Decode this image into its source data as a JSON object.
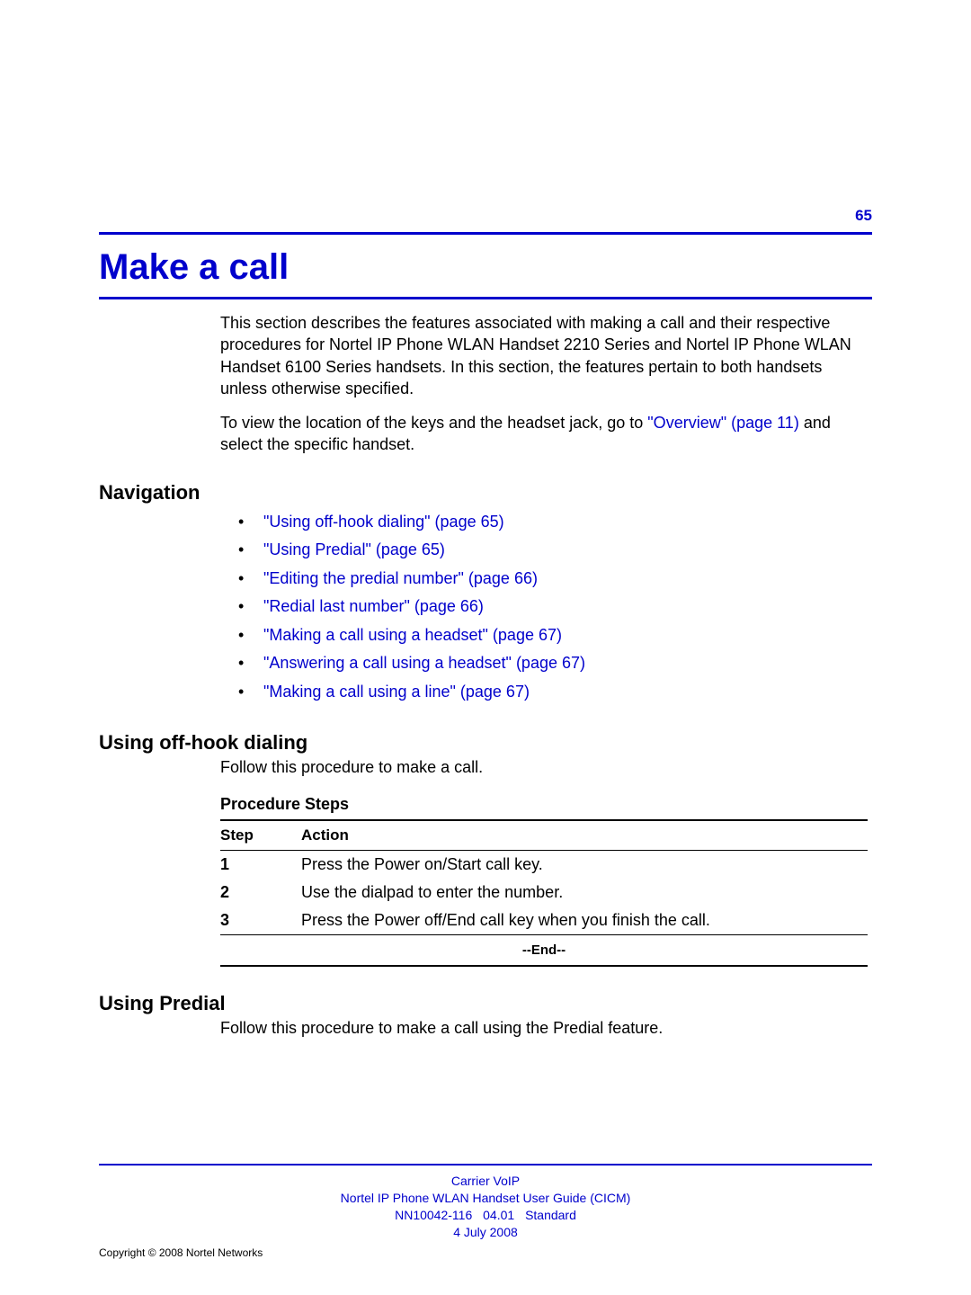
{
  "page_number": "65",
  "title": "Make a call",
  "intro_paragraph_1": "This section describes the features associated with making a call and their respective procedures for Nortel IP Phone WLAN Handset 2210 Series and Nortel IP Phone WLAN Handset 6100 Series handsets. In this section, the features pertain to both handsets unless otherwise specified.",
  "intro_paragraph_2_pre": "To view the location of the keys and the headset jack, go to ",
  "intro_link": "\"Overview\" (page 11)",
  "intro_paragraph_2_post": " and select the specific handset.",
  "nav_heading": "Navigation",
  "nav_items": [
    "\"Using off-hook dialing\" (page 65)",
    "\"Using Predial\" (page 65)",
    "\"Editing the predial number\" (page 66)",
    "\"Redial last number\" (page 66)",
    "\"Making a call using a headset\" (page 67)",
    "\"Answering a call using a headset\" (page 67)",
    "\"Making a call using a line\" (page 67)"
  ],
  "section1_heading": "Using off-hook dialing",
  "section1_intro": "Follow this procedure to make a call.",
  "procedure_label": "Procedure Steps",
  "table": {
    "head_step": "Step",
    "head_action": "Action",
    "rows": [
      {
        "step": "1",
        "action": "Press the Power on/Start call key."
      },
      {
        "step": "2",
        "action": "Use the dialpad to enter the number."
      },
      {
        "step": "3",
        "action": "Press the Power off/End call key when you finish the call."
      }
    ],
    "end": "--End--"
  },
  "section2_heading": "Using Predial",
  "section2_intro": "Follow this procedure to make a call using the Predial feature.",
  "footer": {
    "line1": "Carrier VoIP",
    "line2": "Nortel IP Phone WLAN Handset User Guide (CICM)",
    "doc_num": "NN10042-116",
    "doc_rev": "04.01",
    "doc_status": "Standard",
    "date": "4 July 2008",
    "copyright": "Copyright © 2008 Nortel Networks"
  }
}
